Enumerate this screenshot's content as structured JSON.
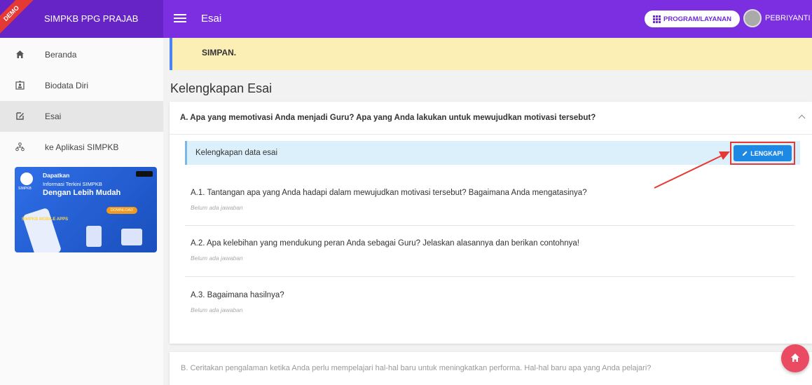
{
  "header": {
    "demo_label": "DEMO",
    "brand": "SIMPKB PPG PRAJAB",
    "page_title": "Esai",
    "program_button": "PROGRAM/LAYANAN",
    "user_name": "PEBRIYANTI"
  },
  "sidebar": {
    "items": [
      {
        "label": "Beranda",
        "icon": "home-icon"
      },
      {
        "label": "Biodata Diri",
        "icon": "id-card-icon"
      },
      {
        "label": "Esai",
        "icon": "edit-icon"
      },
      {
        "label": "ke Aplikasi SIMPKB",
        "icon": "network-icon"
      }
    ],
    "banner": {
      "logo_text": "SIMPKB",
      "title": "Dapatkan",
      "subtitle": "Informasi Terkini SIMPKB",
      "headline": "Dengan Lebih Mudah",
      "download": "DOWNLOAD",
      "apps": "SIMPKB MOBILE APPS"
    }
  },
  "notice": {
    "text": "SIMPAN."
  },
  "section_title": "Kelengkapan Esai",
  "panel_a": {
    "title": "A. Apa yang memotivasi Anda menjadi Guru? Apa yang Anda lakukan untuk mewujudkan motivasi tersebut?",
    "info_label": "Kelengkapan data esai",
    "button_label": "LENGKAPI",
    "questions": [
      {
        "text": "A.1. Tantangan apa yang Anda hadapi dalam mewujudkan motivasi tersebut? Bagaimana Anda mengatasinya?",
        "answer": "Belum ada jawaban"
      },
      {
        "text": "A.2. Apa kelebihan yang mendukung peran Anda sebagai Guru? Jelaskan alasannya dan berikan contohnya!",
        "answer": "Belum ada jawaban"
      },
      {
        "text": "A.3. Bagaimana hasilnya?",
        "answer": "Belum ada jawaban"
      }
    ]
  },
  "panel_b": {
    "title": "B. Ceritakan pengalaman ketika Anda perlu mempelajari hal-hal baru untuk meningkatkan performa. Hal-hal baru apa yang Anda pelajari?"
  },
  "colors": {
    "topbar": "#7b2fe0",
    "accent_button": "#1e88e5",
    "highlight": "#e53935",
    "fab": "#ea4b63"
  }
}
